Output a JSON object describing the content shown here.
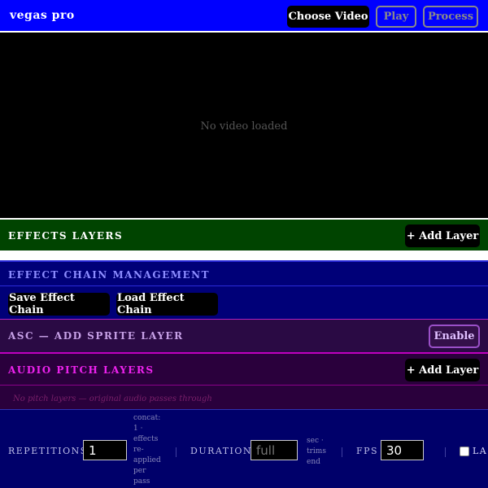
{
  "app": {
    "title": "vegas pro"
  },
  "toolbar": {
    "choose_label": "Choose Video",
    "play_label": "Play",
    "process_label": "Process"
  },
  "video": {
    "placeholder": "No video loaded"
  },
  "effects": {
    "title": "EFFECTS LAYERS",
    "add_label": "+ Add Layer"
  },
  "chain": {
    "title": "EFFECT CHAIN MANAGEMENT",
    "save_label": "Save Effect Chain",
    "load_label": "Load Effect Chain"
  },
  "asc": {
    "title": "ASC — ADD SPRITE LAYER",
    "enable_label": "Enable"
  },
  "audio": {
    "title": "AUDIO PITCH LAYERS",
    "add_label": "+ Add Layer",
    "empty_msg": "No pitch layers — original audio passes through"
  },
  "settings": {
    "repetitions": {
      "label": "REPETITIONS",
      "value": "1",
      "hint": [
        "concat:",
        "1 ·",
        "effects",
        "re-",
        "applied",
        "per",
        "pass"
      ]
    },
    "duration": {
      "label": "DURATION",
      "placeholder": "full",
      "hint": [
        "sec ·",
        "trims",
        "end"
      ]
    },
    "fps": {
      "label": "FPS",
      "value": "30"
    },
    "last": {
      "label": "LAS"
    }
  },
  "colors": {
    "topbar": "#0000ff",
    "effects": "#004400",
    "chain": "#000078",
    "audio_title": "#ee22ee"
  }
}
